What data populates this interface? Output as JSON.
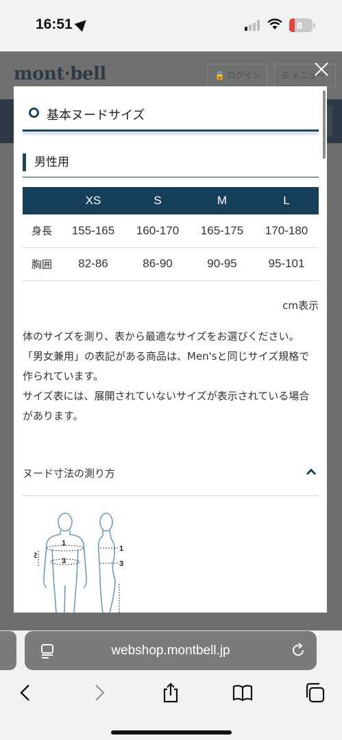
{
  "status_bar": {
    "time": "16:51",
    "battery": "8"
  },
  "site": {
    "logo": "mont·bell",
    "login_label": "ログイン",
    "menu_label": "メニュー"
  },
  "modal": {
    "section_title": "基本ヌードサイズ",
    "sub_title": "男性用",
    "table": {
      "headers": [
        "",
        "XS",
        "S",
        "M",
        "L"
      ],
      "rows": [
        {
          "label": "身長",
          "values": [
            "155-165",
            "160-170",
            "165-175",
            "170-180"
          ]
        },
        {
          "label": "胸囲",
          "values": [
            "82-86",
            "86-90",
            "90-95",
            "95-101"
          ]
        }
      ]
    },
    "unit_note": "cm表示",
    "description": [
      "体のサイズを測り、表から最適なサイズをお選びください。",
      "「男女兼用」の表記がある商品は、Men'sと同じサイズ規格で作られています。",
      "サイズ表には、展開されていないサイズが表示されている場合があります。"
    ],
    "accordion_label": "ヌード寸法の測り方",
    "figure_labels": [
      "1",
      "2",
      "3",
      "1",
      "3"
    ]
  },
  "browser": {
    "url": "webshop.montbell.jp"
  },
  "icons": {
    "close": "close-icon",
    "reader": "reader-icon",
    "reload": "reload-icon",
    "back": "back-icon",
    "forward": "forward-icon",
    "share": "share-icon",
    "bookmarks": "bookmarks-icon",
    "tabs": "tabs-icon"
  },
  "colors": {
    "accent": "#1d4560",
    "table_header": "#163f5c"
  }
}
